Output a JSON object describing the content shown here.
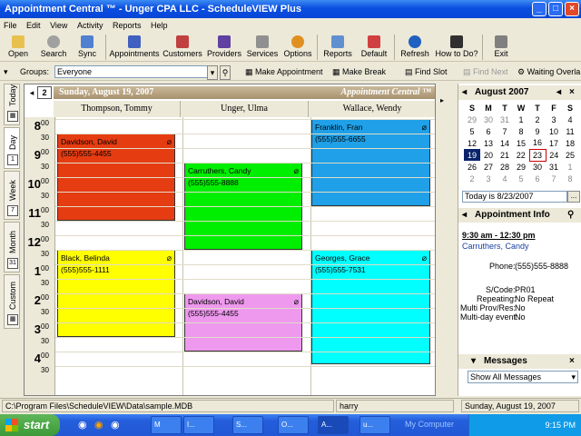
{
  "window": {
    "title": "Appointment Central ™ - Unger CPA LLC - ScheduleVIEW Plus"
  },
  "menu": [
    "File",
    "Edit",
    "View",
    "Activity",
    "Reports",
    "Help"
  ],
  "toolbar": [
    "Open",
    "Search",
    "Sync",
    "Appointments",
    "Customers",
    "Providers",
    "Services",
    "Options",
    "Reports",
    "Default",
    "Refresh",
    "How to Do?",
    "Exit"
  ],
  "groups_bar": {
    "label": "Groups:",
    "value": "Everyone",
    "make_appointment": "Make Appointment",
    "make_break": "Make Break",
    "find_slot": "Find Slot",
    "find_next": "Find Next",
    "waiting": "Waiting Overla"
  },
  "left_tabs": [
    "Today",
    "Day",
    "Week",
    "Month",
    "Custom"
  ],
  "schedule": {
    "date": "Sunday, August 19, 2007",
    "brand": "Appointment Central ™",
    "providers": [
      "Thompson, Tommy",
      "Unger, Ulma",
      "Wallace, Wendy"
    ],
    "hours": [
      "8",
      "9",
      "10",
      "11",
      "12",
      "1",
      "2",
      "3",
      "4"
    ],
    "minutes": [
      "00",
      "30"
    ],
    "appointments": [
      {
        "name": "Davidson, David",
        "phone": "(555)555-4455",
        "color": "#e63c12"
      },
      {
        "name": "Black, Belinda",
        "phone": "(555)555-1111",
        "color": "#ffff00"
      },
      {
        "name": "Carruthers, Candy",
        "phone": "(555)555-8888",
        "color": "#00ee00"
      },
      {
        "name": "Davidson, David",
        "phone": "(555)555-4455",
        "color": "#ee99ee"
      },
      {
        "name": "Franklin, Fran",
        "phone": "(555)555-6655",
        "color": "#1fa0e8"
      },
      {
        "name": "Georges, Grace",
        "phone": "(555)555-7531",
        "color": "#00ffff"
      }
    ]
  },
  "minical": {
    "month": "August 2007",
    "weekdays": [
      "S",
      "M",
      "T",
      "W",
      "T",
      "F",
      "S"
    ],
    "weeks": [
      [
        "29",
        "30",
        "31",
        "1",
        "2",
        "3",
        "4"
      ],
      [
        "5",
        "6",
        "7",
        "8",
        "9",
        "10",
        "11"
      ],
      [
        "12",
        "13",
        "14",
        "15",
        "16",
        "17",
        "18"
      ],
      [
        "19",
        "20",
        "21",
        "22",
        "23",
        "24",
        "25"
      ],
      [
        "26",
        "27",
        "28",
        "29",
        "30",
        "31",
        "1"
      ],
      [
        "2",
        "3",
        "4",
        "5",
        "6",
        "7",
        "8"
      ]
    ],
    "today_text": "Today is 8/23/2007",
    "today_button": "..."
  },
  "appt_info": {
    "header": "Appointment Info",
    "time": "9:30 am - 12:30 pm",
    "customer": "Carruthers, Candy",
    "phone_label": "Phone:",
    "phone": "(555)555-8888",
    "scode_label": "S/Code:",
    "scode": "PR01",
    "repeating_label": "Repeating:",
    "repeating": "No Repeat",
    "multi_prov_label": "Multi Prov/Res:",
    "multi_prov": "No",
    "multi_day_label": "Multi-day event:",
    "multi_day": "No"
  },
  "messages": {
    "header": "Messages",
    "filter": "Show All Messages"
  },
  "status": {
    "path": "C:\\Program Files\\ScheduleVIEW\\Data\\sample.MDB",
    "user": "harry",
    "date": "Sunday, August 19, 2007"
  },
  "taskbar": {
    "start": "start",
    "tasks": [
      "M",
      "I...",
      "S...",
      "O...",
      "A...",
      "u..."
    ],
    "my_computer": "My Computer",
    "clock": "9:15 PM"
  }
}
